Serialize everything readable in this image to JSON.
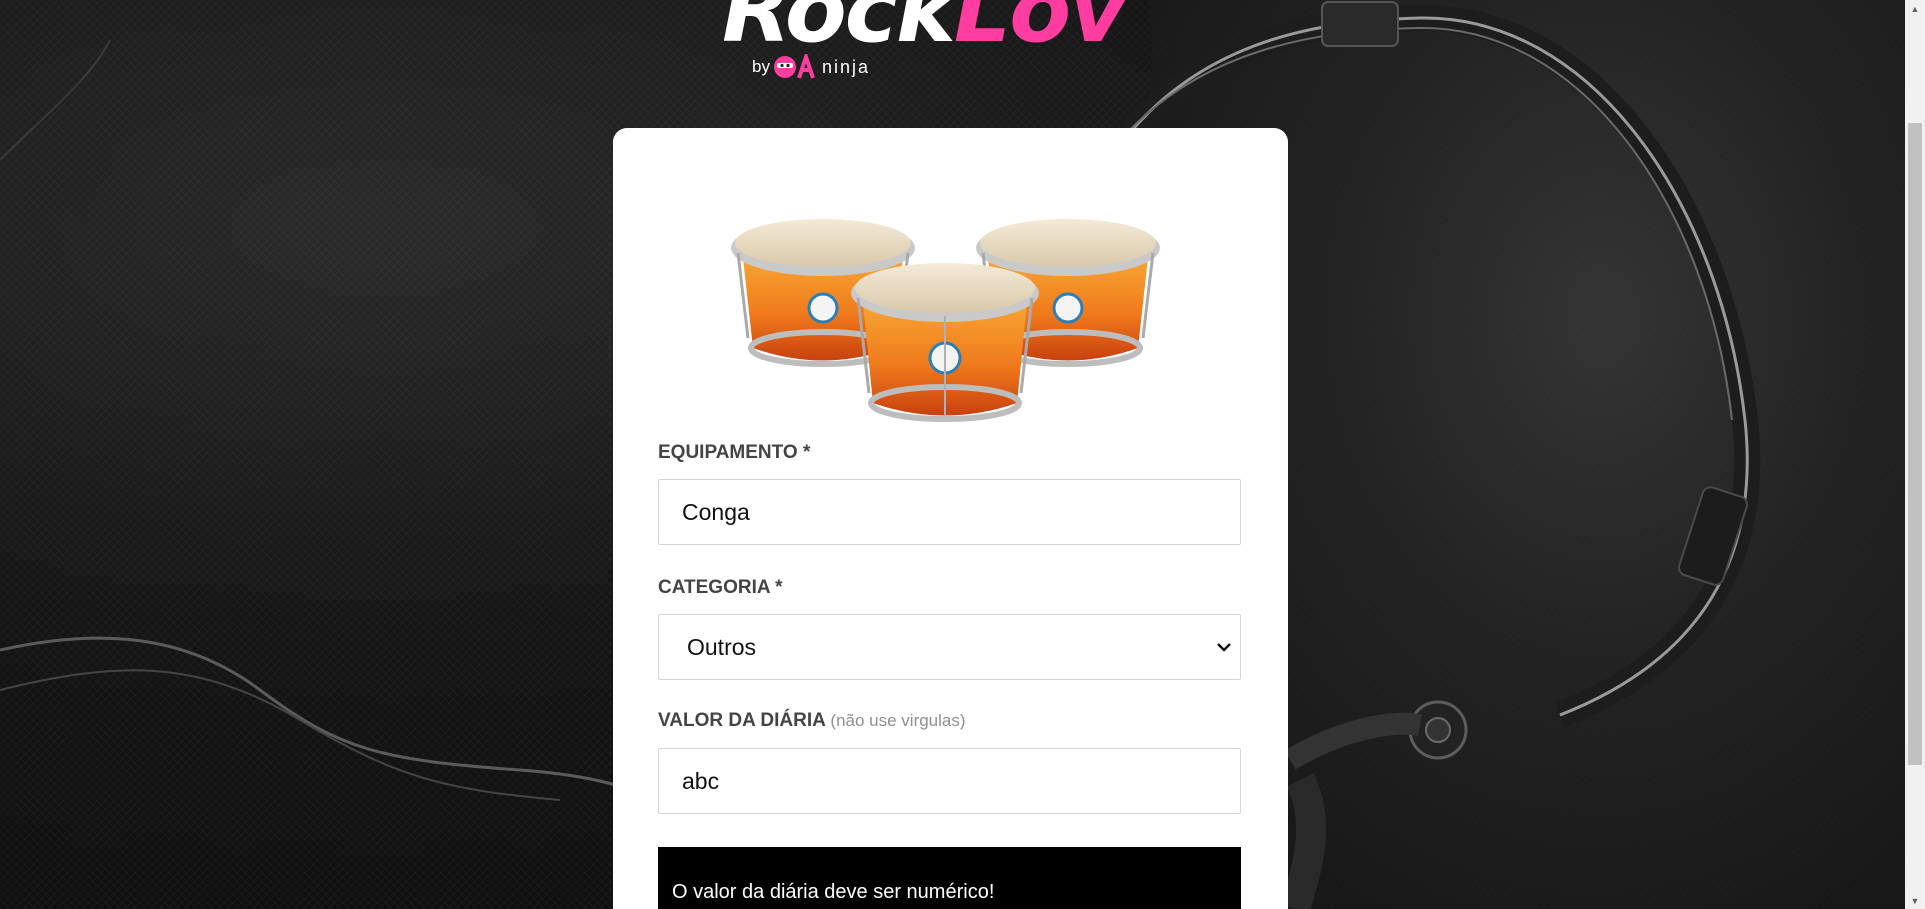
{
  "logo": {
    "word_white": "Rock",
    "word_pink": "Lov",
    "by": "by",
    "qa": "QA",
    "ninja": "ninja",
    "accent_color": "#ff3c9f"
  },
  "equipment_image": {
    "icon": "bongo-drums-image"
  },
  "form": {
    "equipamento": {
      "label": "EQUIPAMENTO *",
      "value": "Conga"
    },
    "categoria": {
      "label": "CATEGORIA *",
      "value": "Outros",
      "icon": "chevron-down-icon"
    },
    "valor_diaria": {
      "label": "VALOR DA DIÁRIA",
      "hint": "(não use virgulas)",
      "value": "abc"
    },
    "error_message": "O valor da diária deve ser numérico!"
  },
  "scrollbar": {
    "up_icon": "scroll-up-arrow-icon",
    "down_icon": "scroll-down-arrow-icon"
  }
}
